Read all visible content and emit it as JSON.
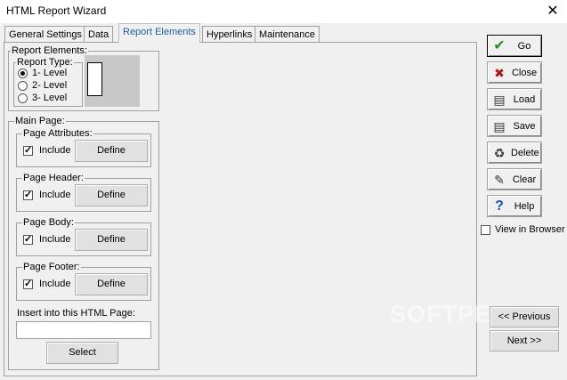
{
  "window": {
    "title": "HTML Report Wizard",
    "close_glyph": "✕"
  },
  "tabs": [
    {
      "label": "General Settings"
    },
    {
      "label": "Data"
    },
    {
      "label": "Report Elements",
      "active": true
    },
    {
      "label": "Hyperlinks"
    },
    {
      "label": "Maintenance"
    }
  ],
  "report_elements": {
    "group_label": "Report Elements:",
    "report_type": {
      "label": "Report Type:",
      "options": [
        "1- Level",
        "2- Level",
        "3- Level"
      ],
      "selected": "1- Level"
    }
  },
  "main_page": {
    "label": "Main Page:",
    "sections": [
      {
        "label": "Page Attributes:",
        "include_label": "Include",
        "checked": true,
        "button": "Define"
      },
      {
        "label": "Page Header:",
        "include_label": "Include",
        "checked": true,
        "button": "Define"
      },
      {
        "label": "Page Body:",
        "include_label": "Include",
        "checked": true,
        "button": "Define"
      },
      {
        "label": "Page Footer:",
        "include_label": "Include",
        "checked": true,
        "button": "Define"
      }
    ],
    "insert_label": "Insert into this HTML Page:",
    "insert_value": "",
    "select_button": "Select"
  },
  "side_buttons": [
    {
      "label": "Go",
      "icon": "check-icon",
      "glyph": "✔",
      "color": "#2a8a2a"
    },
    {
      "label": "Close",
      "icon": "close-x-icon",
      "glyph": "✖",
      "color": "#b01818"
    },
    {
      "label": "Load",
      "icon": "document-icon",
      "glyph": "▤",
      "color": "#333333"
    },
    {
      "label": "Save",
      "icon": "save-document-icon",
      "glyph": "▤",
      "color": "#333333"
    },
    {
      "label": "Delete",
      "icon": "trash-icon",
      "glyph": "♻",
      "color": "#333333"
    },
    {
      "label": "Clear",
      "icon": "brush-icon",
      "glyph": "✎",
      "color": "#333333"
    },
    {
      "label": "Help",
      "icon": "question-icon",
      "glyph": "?",
      "color": "#1a4fb0"
    }
  ],
  "view_in_browser": {
    "label": "View in Browser",
    "checked": false
  },
  "nav": {
    "previous": "<< Previous",
    "next": "Next >>"
  },
  "watermark": "SOFTPEDIA"
}
